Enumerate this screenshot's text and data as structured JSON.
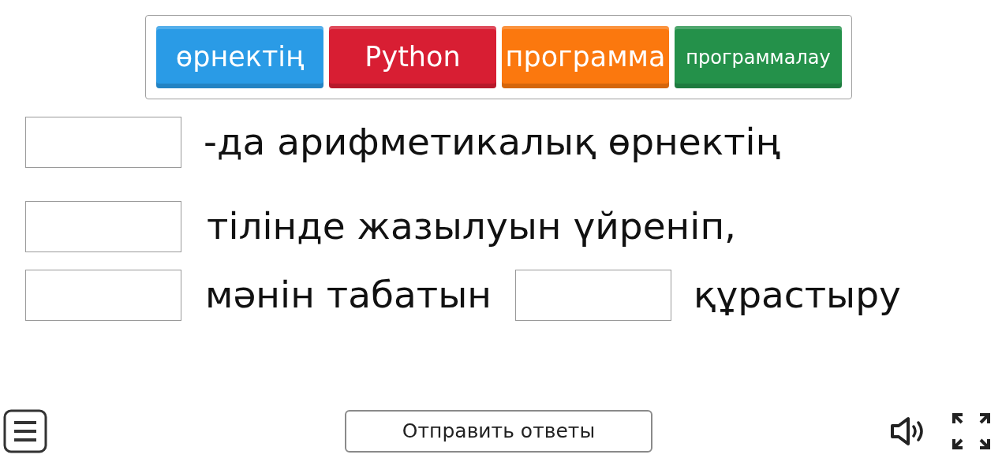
{
  "word_bank": [
    {
      "label": "өрнектің",
      "color": "#2a9be6"
    },
    {
      "label": "Python",
      "color": "#d81e33"
    },
    {
      "label": "программа",
      "color": "#fb780e"
    },
    {
      "label": "программалау",
      "color": "#24914a"
    }
  ],
  "sentence_rows": [
    [
      {
        "kind": "blank"
      },
      {
        "kind": "text",
        "text": "-да арифметикалық өрнектің"
      }
    ],
    [
      {
        "kind": "blank"
      },
      {
        "kind": "text",
        "text": "тілінде жазылуын үйреніп,"
      }
    ],
    [
      {
        "kind": "blank"
      },
      {
        "kind": "text",
        "text": "мәнін табатын"
      },
      {
        "kind": "blank"
      },
      {
        "kind": "text",
        "text": "құрастыру"
      }
    ]
  ],
  "submit_button": {
    "label": "Отправить ответы"
  }
}
